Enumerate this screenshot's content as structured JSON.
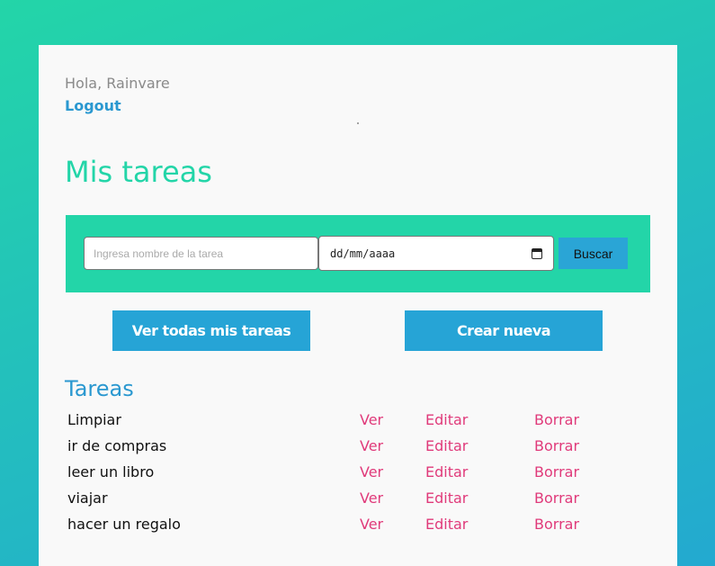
{
  "header": {
    "greeting": "Hola, Rainvare",
    "logout_label": "Logout"
  },
  "page_title": "Mis tareas",
  "search": {
    "task_placeholder": "Ingresa nombre de la tarea",
    "date_placeholder": "dd/mm/aaaa",
    "button_label": "Buscar"
  },
  "actions": {
    "view_all_label": "Ver todas mis tareas",
    "create_label": "Crear nueva"
  },
  "tasks_section": {
    "title": "Tareas",
    "items": [
      {
        "name": "Limpiar",
        "view": "Ver",
        "edit": "Editar",
        "delete": "Borrar"
      },
      {
        "name": "ir de compras",
        "view": "Ver",
        "edit": "Editar",
        "delete": "Borrar"
      },
      {
        "name": "leer un libro",
        "view": "Ver",
        "edit": "Editar",
        "delete": "Borrar"
      },
      {
        "name": "viajar",
        "view": "Ver",
        "edit": "Editar",
        "delete": "Borrar"
      },
      {
        "name": "hacer un regalo",
        "view": "Ver",
        "edit": "Editar",
        "delete": "Borrar"
      }
    ]
  },
  "colors": {
    "accent_green": "#23d5a8",
    "accent_blue": "#26a4d6",
    "action_pink": "#e03a7a"
  }
}
